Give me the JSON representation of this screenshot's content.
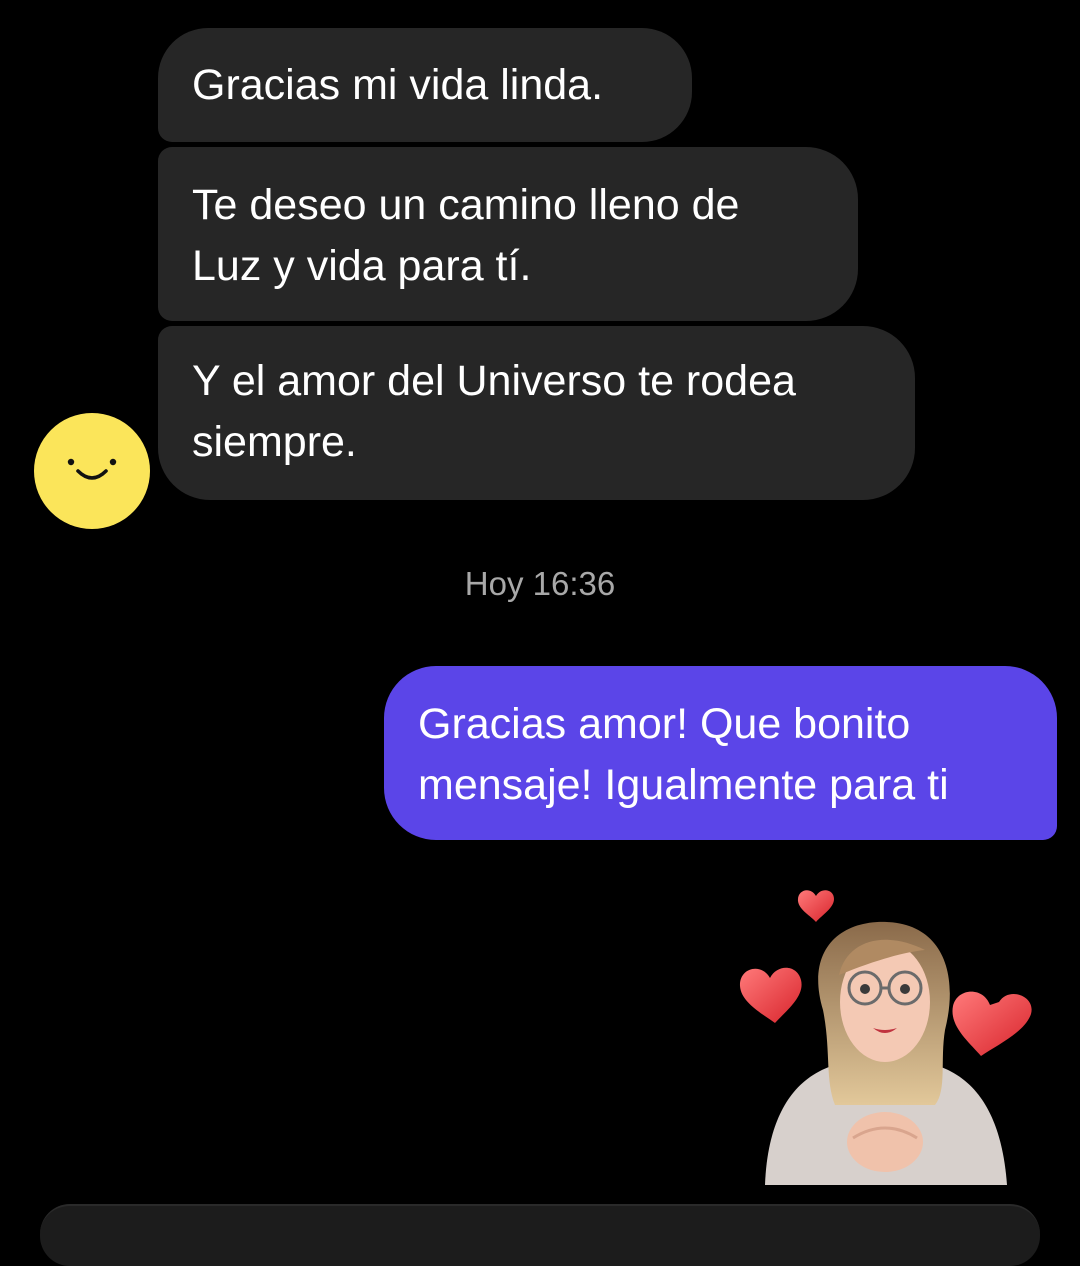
{
  "thread": {
    "incoming_messages": [
      {
        "lines": [
          "Gracias mi vida linda."
        ]
      },
      {
        "lines": [
          "Te deseo un camino lleno de",
          "Luz y vida para tí."
        ]
      },
      {
        "lines": [
          "Y el amor del Universo te rodea",
          "siempre."
        ]
      }
    ],
    "timestamp": "Hoy 16:36",
    "outgoing_messages": [
      {
        "lines": [
          "Gracias amor! Que bonito",
          "mensaje! Igualmente para ti"
        ]
      }
    ],
    "sender_avatar_icon": "smiley-face-icon",
    "sticker_icon": "avatar-hearts-sticker"
  },
  "colors": {
    "background": "#000000",
    "incoming_bubble": "#262626",
    "outgoing_bubble": "#5b45e8",
    "avatar": "#fbe55a",
    "timestamp_text": "#a8a8a8"
  }
}
